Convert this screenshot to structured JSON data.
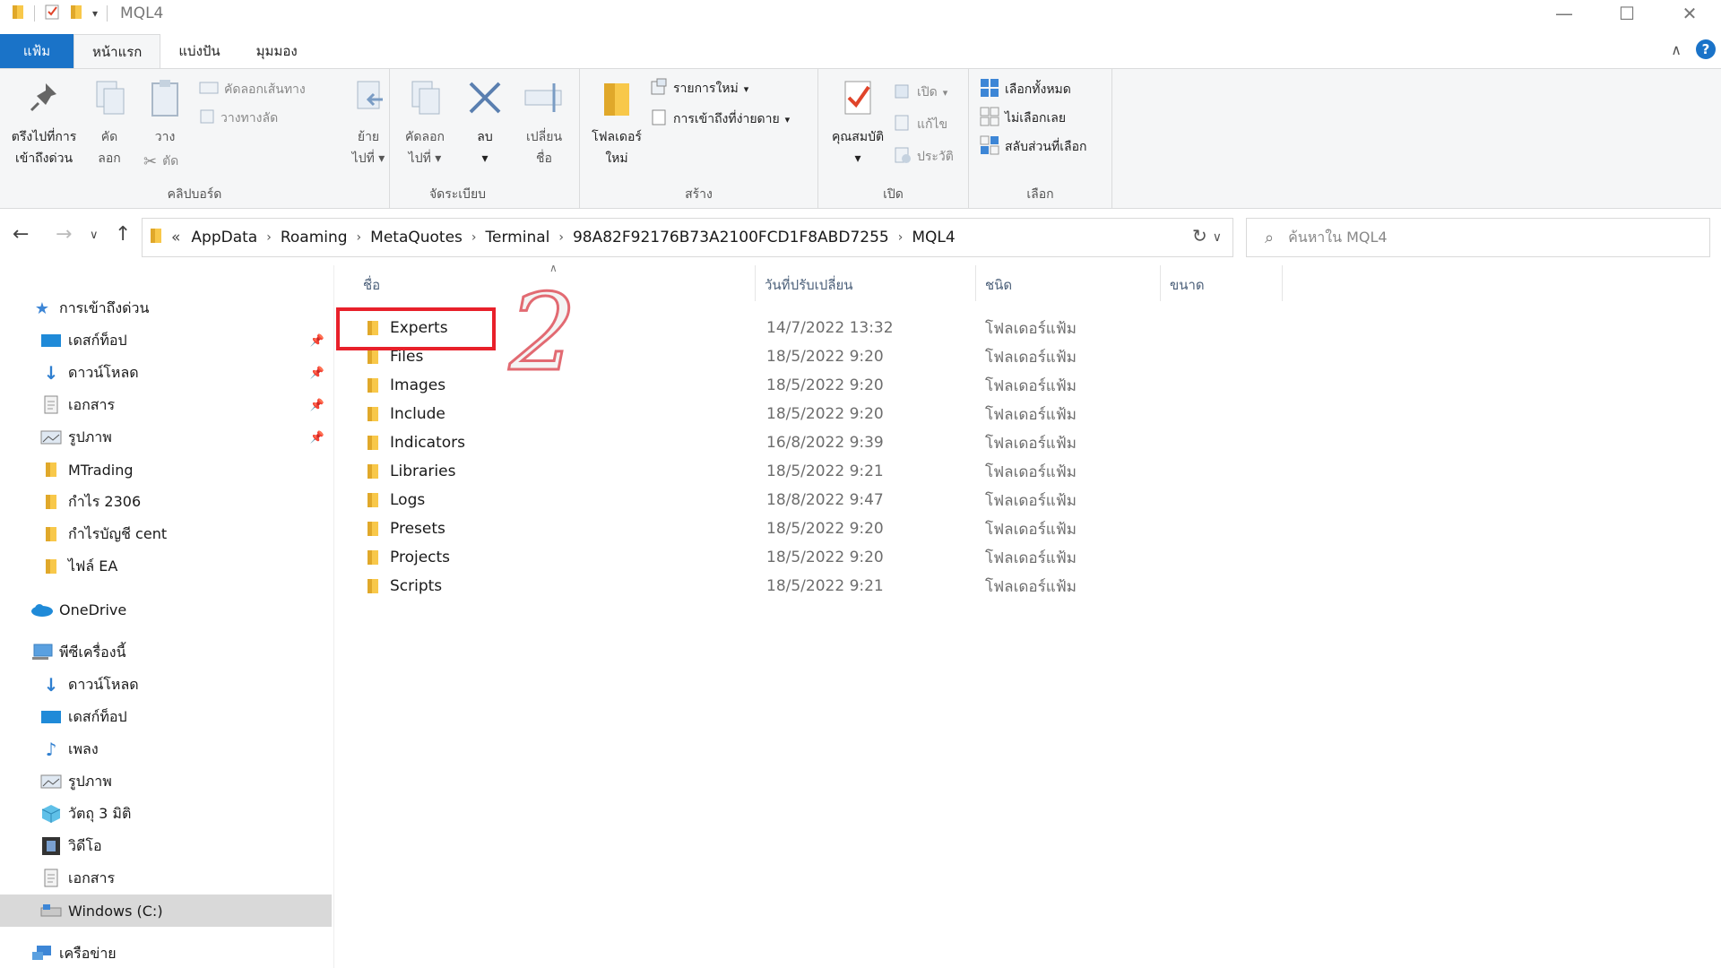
{
  "window": {
    "title": "MQL4"
  },
  "tabs": [
    {
      "label": "แฟ้ม"
    },
    {
      "label": "หน้าแรก"
    },
    {
      "label": "แบ่งปัน"
    },
    {
      "label": "มุมมอง"
    }
  ],
  "ribbon": {
    "clipboard": {
      "label": "คลิปบอร์ด",
      "pin_l1": "ตรึงไปที่การ",
      "pin_l2": "เข้าถึงด่วน",
      "copy_l1": "คัด",
      "copy_l2": "ลอก",
      "paste": "วาง",
      "copy_path": "คัดลอกเส้นทาง",
      "paste_shortcut": "วางทางลัด",
      "cut": "ตัด"
    },
    "organize": {
      "label": "จัดระเบียบ",
      "move_l1": "ย้าย",
      "move_l2": "ไปที่",
      "copyto_l1": "คัดลอก",
      "copyto_l2": "ไปที่",
      "delete": "ลบ",
      "rename_l1": "เปลี่ยน",
      "rename_l2": "ชื่อ"
    },
    "new": {
      "label": "สร้าง",
      "folder_l1": "โฟลเดอร์",
      "folder_l2": "ใหม่",
      "new_item": "รายการใหม่",
      "easy_access": "การเข้าถึงที่ง่ายดาย"
    },
    "open": {
      "label": "เปิด",
      "properties": "คุณสมบัติ",
      "open": "เปิด",
      "edit": "แก้ไข",
      "history": "ประวัติ"
    },
    "select": {
      "label": "เลือก",
      "select_all": "เลือกทั้งหมด",
      "select_none": "ไม่เลือกเลย",
      "invert": "สลับส่วนที่เลือก"
    }
  },
  "address": {
    "prefix": "«",
    "crumbs": [
      "AppData",
      "Roaming",
      "MetaQuotes",
      "Terminal",
      "98A82F92176B73A2100FCD1F8ABD7255",
      "MQL4"
    ]
  },
  "search": {
    "placeholder": "ค้นหาใน MQL4"
  },
  "nav": {
    "quick_access": "การเข้าถึงด่วน",
    "qa_items": [
      "เดสก์ท็อป",
      "ดาวน์โหลด",
      "เอกสาร",
      "รูปภาพ",
      "MTrading",
      "กำไร 2306",
      "กำไรบัญชี cent",
      "ไฟล์ EA"
    ],
    "onedrive": "OneDrive",
    "this_pc": "พีซีเครื่องนี้",
    "pc_items": [
      "ดาวน์โหลด",
      "เดสก์ท็อป",
      "เพลง",
      "รูปภาพ",
      "วัตถุ 3 มิติ",
      "วิดีโอ",
      "เอกสาร",
      "Windows (C:)"
    ],
    "network": "เครือข่าย"
  },
  "columns": {
    "name": "ชื่อ",
    "date": "วันที่ปรับเปลี่ยน",
    "type": "ชนิด",
    "size": "ขนาด"
  },
  "files": [
    {
      "name": "Experts",
      "date": "14/7/2022 13:32",
      "type": "โฟลเดอร์แฟ้ม"
    },
    {
      "name": "Files",
      "date": "18/5/2022 9:20",
      "type": "โฟลเดอร์แฟ้ม"
    },
    {
      "name": "Images",
      "date": "18/5/2022 9:20",
      "type": "โฟลเดอร์แฟ้ม"
    },
    {
      "name": "Include",
      "date": "18/5/2022 9:20",
      "type": "โฟลเดอร์แฟ้ม"
    },
    {
      "name": "Indicators",
      "date": "16/8/2022 9:39",
      "type": "โฟลเดอร์แฟ้ม"
    },
    {
      "name": "Libraries",
      "date": "18/5/2022 9:21",
      "type": "โฟลเดอร์แฟ้ม"
    },
    {
      "name": "Logs",
      "date": "18/8/2022 9:47",
      "type": "โฟลเดอร์แฟ้ม"
    },
    {
      "name": "Presets",
      "date": "18/5/2022 9:20",
      "type": "โฟลเดอร์แฟ้ม"
    },
    {
      "name": "Projects",
      "date": "18/5/2022 9:20",
      "type": "โฟลเดอร์แฟ้ม"
    },
    {
      "name": "Scripts",
      "date": "18/5/2022 9:21",
      "type": "โฟลเดอร์แฟ้ม"
    }
  ],
  "annotation": {
    "step": "2"
  },
  "colors": {
    "accent": "#1a73c8",
    "folder": "#f8c84a",
    "highlight": "#e8202a"
  }
}
